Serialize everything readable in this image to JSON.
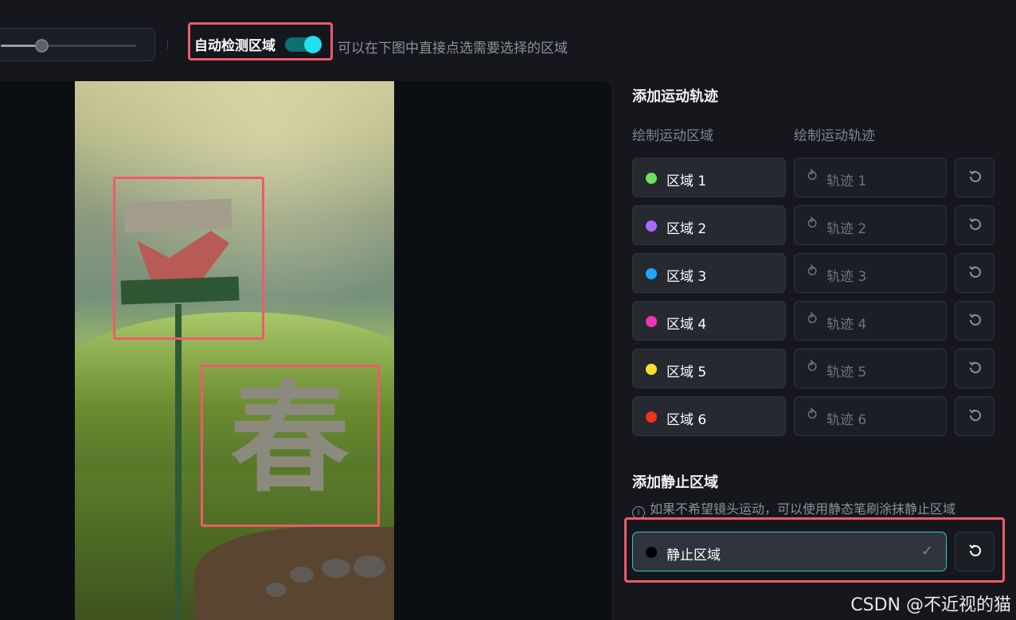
{
  "toolbar": {
    "slider_value": 0.3,
    "auto_detect_label": "自动检测区域",
    "auto_detect_on": true,
    "auto_detect_hint": "可以在下图中直接点选需要选择的区域"
  },
  "canvas": {
    "image_character": "春"
  },
  "motion": {
    "title": "添加运动轨迹",
    "col_region": "绘制运动区域",
    "col_track": "绘制运动轨迹",
    "rows": [
      {
        "region": "区域 1",
        "color": "#6fe05a",
        "track": "轨迹 1"
      },
      {
        "region": "区域 2",
        "color": "#a66cf5",
        "track": "轨迹 2"
      },
      {
        "region": "区域 3",
        "color": "#1ea8f5",
        "track": "轨迹 3"
      },
      {
        "region": "区域 4",
        "color": "#f035b0",
        "track": "轨迹 4"
      },
      {
        "region": "区域 5",
        "color": "#f5e02a",
        "track": "轨迹 5"
      },
      {
        "region": "区域 6",
        "color": "#f5301e",
        "track": "轨迹 6"
      }
    ]
  },
  "static": {
    "title": "添加静止区域",
    "hint": "如果不希望镜头运动，可以使用静态笔刷涂抹静止区域",
    "label": "静止区域",
    "color": "#000000"
  },
  "watermark": "CSDN @不近视的猫"
}
